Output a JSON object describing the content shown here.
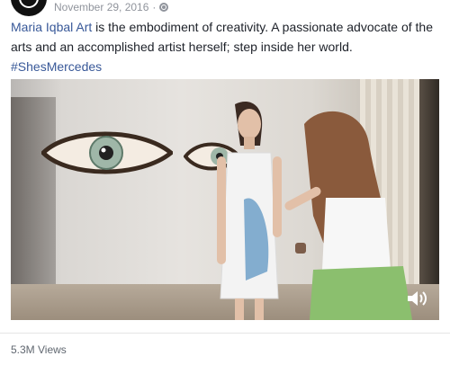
{
  "post": {
    "date": "November 29, 2016",
    "separator": "·",
    "privacy_icon": "globe-icon",
    "author_link": "Maria Iqbal Art",
    "body_text": " is the embodiment of creativity. A passionate advocate of the arts and an accomplished artist herself; step inside her world.",
    "hashtag": "#ShesMercedes"
  },
  "video": {
    "sound_icon": "speaker-icon"
  },
  "stats": {
    "views": "5.3M Views"
  }
}
